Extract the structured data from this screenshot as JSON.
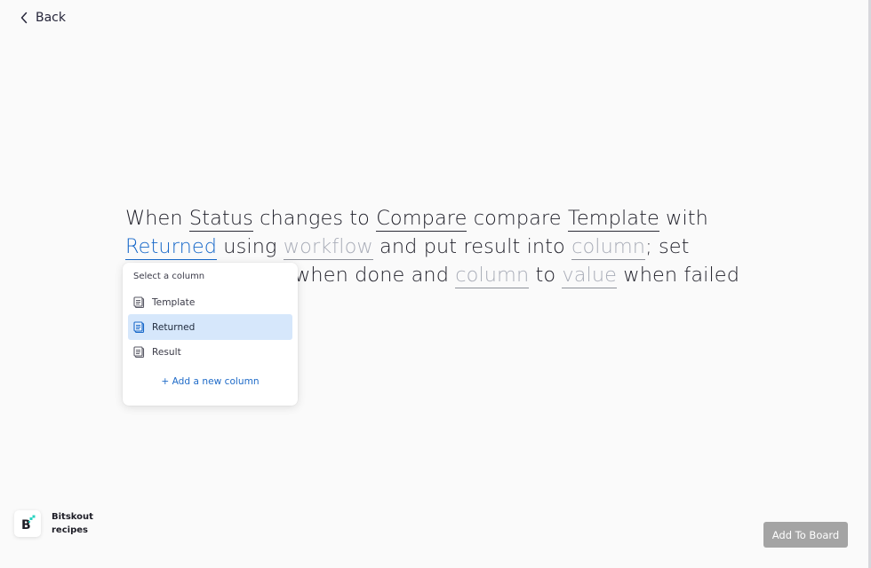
{
  "nav": {
    "back_label": "Back"
  },
  "recipe": {
    "line1": {
      "t1": "When ",
      "status": "Status",
      "t2": " changes to ",
      "compare": "Compare",
      "t3": " compare ",
      "template": "Template",
      "t4": " with"
    },
    "line2": {
      "returned": "Returned",
      "t1": " using ",
      "workflow": "workflow",
      "t2": " and put result into ",
      "column": "column",
      "t3": "; set"
    },
    "line3": {
      "t1": "when done and ",
      "column": "column",
      "t2": " to ",
      "value": "value",
      "t3": " when failed"
    }
  },
  "dropdown": {
    "header": "Select a column",
    "options": [
      "Template",
      "Returned",
      "Result"
    ],
    "selected": "Returned",
    "add_label": "+ Add a new column"
  },
  "brand": {
    "name_line1": "Bitskout",
    "name_line2": "recipes",
    "logo_letter": "B",
    "logo_icon": "bitskout-logo-icon"
  },
  "actions": {
    "add_to_board": "Add To Board"
  },
  "colors": {
    "accent": "#1768c9",
    "selected_bg": "#d6e7fb",
    "placeholder": "#a9adb8",
    "button_disabled": "#a4a4a4",
    "logo_accent": "#2ad3c0"
  }
}
